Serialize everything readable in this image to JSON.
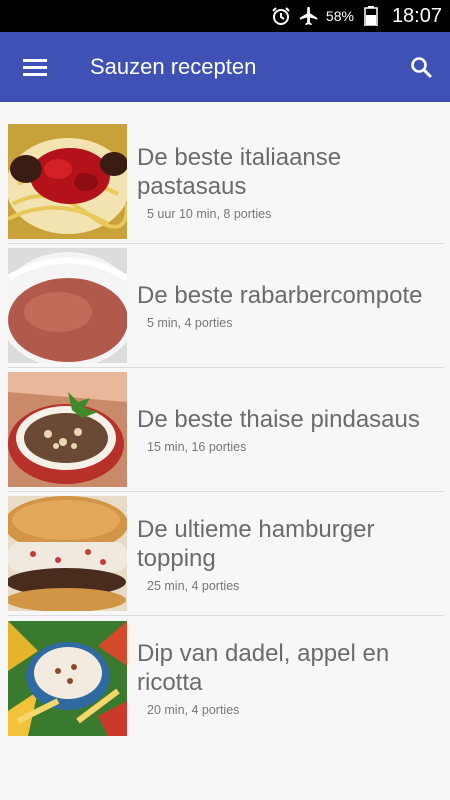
{
  "status": {
    "battery": "58%",
    "time": "18:07"
  },
  "appbar": {
    "title": "Sauzen recepten"
  },
  "recipes": [
    {
      "title": "De beste italiaanse pastasaus",
      "meta": "5 uur 10 min, 8 porties"
    },
    {
      "title": "De beste rabarbercompote",
      "meta": "5 min, 4 porties"
    },
    {
      "title": "De beste thaise pindasaus",
      "meta": "15 min, 16 porties"
    },
    {
      "title": "De ultieme hamburger topping",
      "meta": "25 min, 4 porties"
    },
    {
      "title": "Dip van dadel, appel en ricotta",
      "meta": "20 min, 4 porties"
    }
  ]
}
